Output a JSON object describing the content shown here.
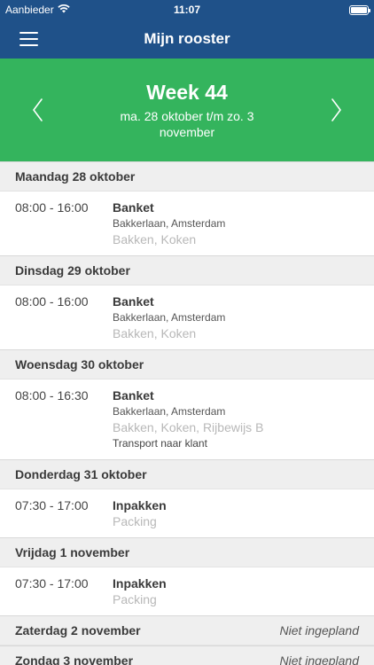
{
  "status_bar": {
    "carrier": "Aanbieder",
    "time": "11:07",
    "battery_level": 1.0
  },
  "navbar": {
    "title": "Mijn rooster",
    "menu_icon": "hamburger-menu-icon"
  },
  "week": {
    "title": "Week 44",
    "range": "ma. 28 oktober t/m zo. 3 november",
    "prev_icon": "chevron-left-icon",
    "next_icon": "chevron-right-icon"
  },
  "colors": {
    "navbar": "#1f5189",
    "week_header": "#34b45d",
    "day_header": "#efefef"
  },
  "days": [
    {
      "label": "Maandag 28 oktober",
      "shift": {
        "time": "08:00 - 16:00",
        "name": "Banket",
        "location": "Bakkerlaan, Amsterdam",
        "tags": "Bakken, Koken"
      }
    },
    {
      "label": "Dinsdag 29 oktober",
      "shift": {
        "time": "08:00 - 16:00",
        "name": "Banket",
        "location": "Bakkerlaan, Amsterdam",
        "tags": "Bakken, Koken"
      }
    },
    {
      "label": "Woensdag 30 oktober",
      "shift": {
        "time": "08:00 - 16:30",
        "name": "Banket",
        "location": "Bakkerlaan, Amsterdam",
        "tags": "Bakken, Koken, Rijbewijs B",
        "note": "Transport naar klant"
      }
    },
    {
      "label": "Donderdag 31 oktober",
      "shift": {
        "time": "07:30 - 17:00",
        "name": "Inpakken",
        "tags": "Packing"
      }
    },
    {
      "label": "Vrijdag 1 november",
      "shift": {
        "time": "07:30 - 17:00",
        "name": "Inpakken",
        "tags": "Packing"
      }
    },
    {
      "label": "Zaterdag 2 november",
      "status": "Niet ingepland"
    },
    {
      "label": "Zondag 3 november",
      "status": "Niet ingepland"
    }
  ]
}
